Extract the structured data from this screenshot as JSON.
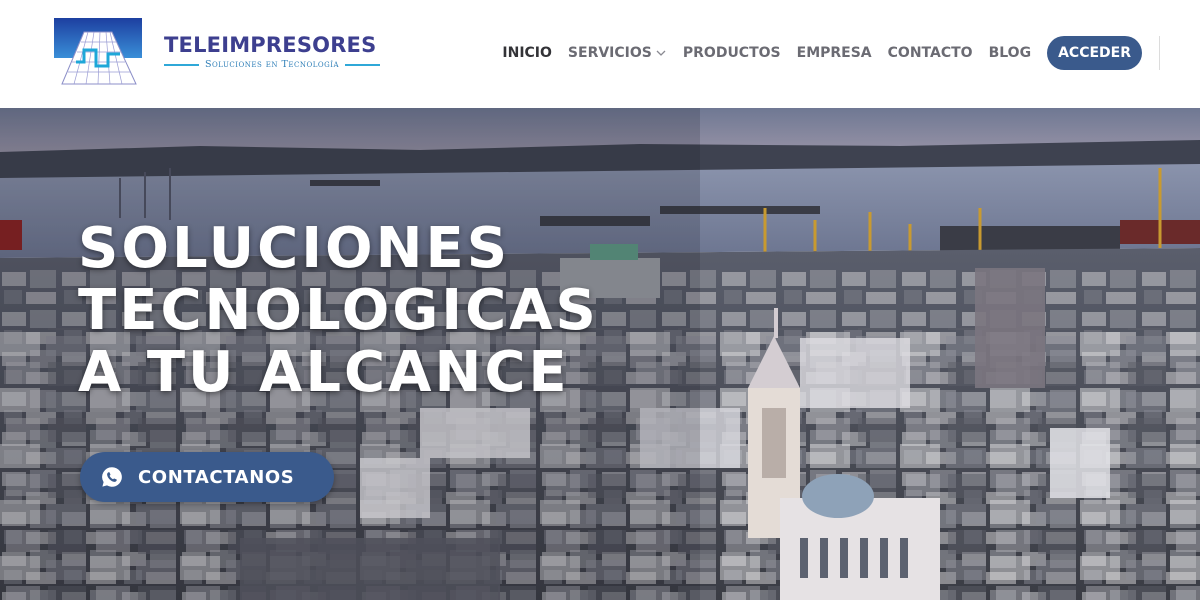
{
  "brand": {
    "name": "TELEIMPRESORES",
    "tagline": "Soluciones en Tecnología",
    "logo_icon": "teleimpresores-logo"
  },
  "nav": {
    "items": [
      {
        "label": "INICIO",
        "active": true
      },
      {
        "label": "SERVICIOS",
        "has_dropdown": true
      },
      {
        "label": "PRODUCTOS"
      },
      {
        "label": "EMPRESA"
      },
      {
        "label": "CONTACTO"
      },
      {
        "label": "BLOG"
      }
    ],
    "cta_label": "ACCEDER"
  },
  "hero": {
    "title_lines": [
      "SOLUCIONES",
      "TECNOLOGICAS",
      "A TU ALCANCE"
    ],
    "cta_label": "CONTACTANOS",
    "cta_icon": "whatsapp-icon",
    "background": "aerial-city-harbor-photo"
  },
  "colors": {
    "primary": "#3a5a8c",
    "brand_text": "#3d3f8f",
    "accent_line": "#2fa8d8",
    "nav_text": "#6b6b73"
  }
}
